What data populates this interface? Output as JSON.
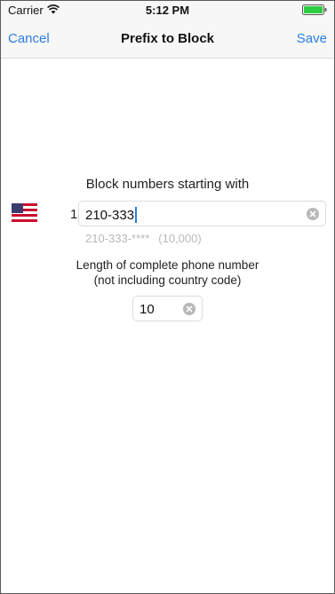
{
  "status_bar": {
    "carrier": "Carrier",
    "time": "5:12 PM",
    "battery_color": "#2ecc40"
  },
  "nav": {
    "cancel_label": "Cancel",
    "title": "Prefix to Block",
    "save_label": "Save",
    "accent_color": "#2a7de1"
  },
  "prefix_section": {
    "label": "Block numbers starting with",
    "flag_icon": "us-flag-icon",
    "country_code": "1",
    "prefix_value": "210-333",
    "hint_pattern": "210-333-****",
    "hint_count": "(10,000)"
  },
  "length_section": {
    "label_line1": "Length of complete phone number",
    "label_line2": "(not including country code)",
    "length_value": "10"
  }
}
